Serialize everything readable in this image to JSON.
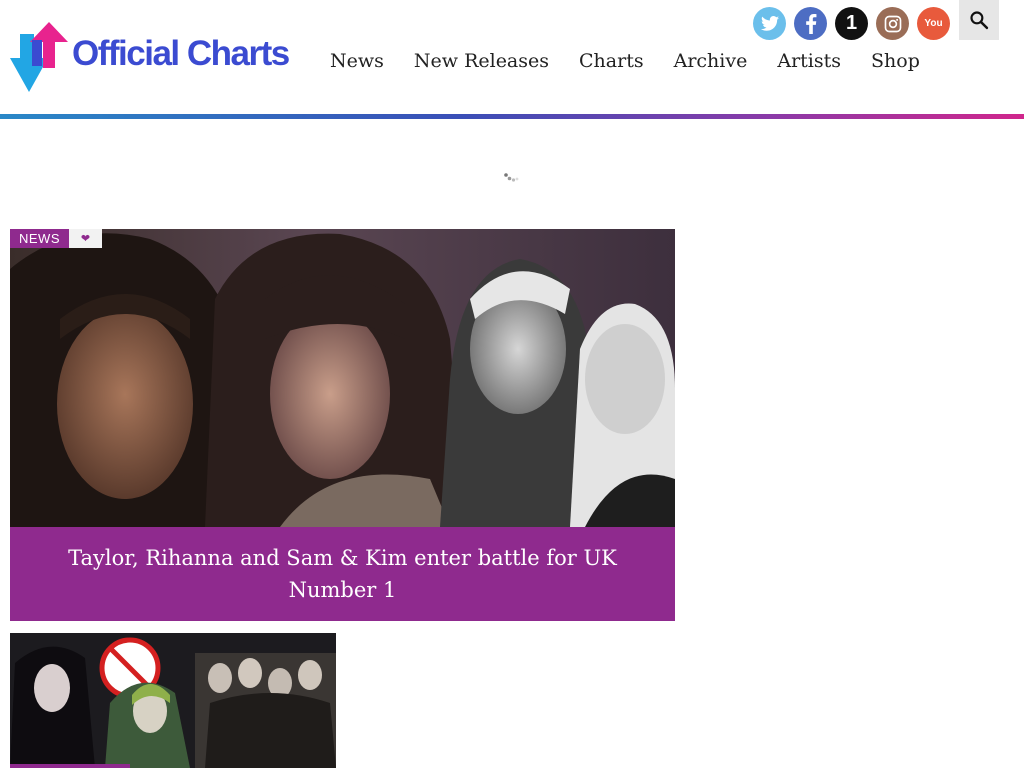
{
  "header": {
    "logo_text": "Official Charts",
    "nav": [
      "News",
      "New Releases",
      "Charts",
      "Archive",
      "Artists",
      "Shop"
    ],
    "social": [
      {
        "name": "twitter-icon",
        "glyph": "🐦"
      },
      {
        "name": "facebook-icon",
        "glyph": "f"
      },
      {
        "name": "official-charts-1-icon",
        "glyph": "1"
      },
      {
        "name": "instagram-icon",
        "glyph": "▣"
      },
      {
        "name": "youtube-icon",
        "glyph": "You"
      }
    ],
    "search_icon": "search-icon"
  },
  "colors": {
    "brand_purple": "#8f2a8e",
    "brand_blue": "#3b4bd1",
    "logo_cyan": "#22a6e4",
    "logo_pink": "#e8238e"
  },
  "hero": {
    "tag": "NEWS",
    "tag_icon": "heart-icon",
    "headline": "Taylor, Rihanna and Sam & Kim enter battle for UK Number 1"
  }
}
